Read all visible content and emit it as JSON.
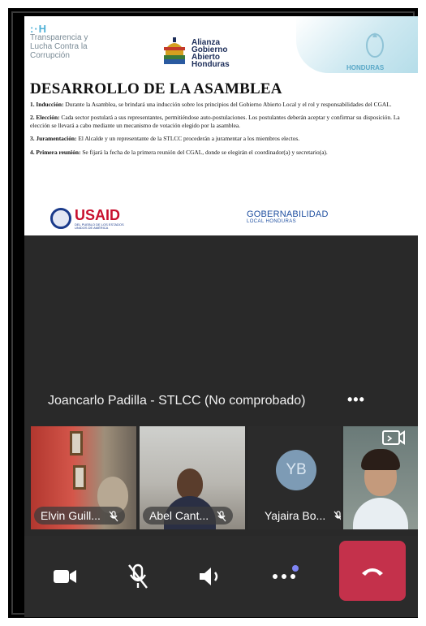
{
  "slide": {
    "logo_left": {
      "mark": ":·H",
      "lines": [
        "Transparencia y",
        "Lucha Contra la",
        "Corrupción"
      ]
    },
    "logo_center": [
      "Alianza",
      "Gobierno",
      "Abierto",
      "Honduras"
    ],
    "logo_right": "HONDURAS",
    "title": "DESARROLLO DE LA ASAMBLEA",
    "points": [
      {
        "label": "1. Inducción:",
        "text": " Durante la Asamblea, se brindará una inducción sobre los principios del Gobierno Abierto Local y el rol y responsabilidades del CGAL."
      },
      {
        "label": "2. Elección:",
        "text": " Cada sector postulará a sus representantes, permitiéndose auto-postulaciones. Los postulantes deberán aceptar y confirmar su disposición. La elección se llevará a cabo mediante un mecanismo de votación elegido por la asamblea."
      },
      {
        "label": "3. Juramentación:",
        "text": " El Alcalde y un representante de la STLCC procederán a juramentar a los miembros electos."
      },
      {
        "label": "4. Primera reunión:",
        "text": " Se fijará la fecha de la primera reunión del CGAL, donde se elegirán el coordinador(a) y secretario(a)."
      }
    ],
    "usaid": {
      "word": "USAID",
      "sub": "DEL PUEBLO DE LOS ESTADOS UNIDOS DE AMÉRICA"
    },
    "gob": {
      "line1": "GOBERNABILIDAD",
      "line2": "LOCAL HONDURAS"
    }
  },
  "speaker": {
    "name": "Joancarlo Padilla - STLCC (No comprobado)",
    "more": "•••"
  },
  "participants": [
    {
      "name": "Elvin Guill...",
      "muted": true
    },
    {
      "name": "Abel Cant...",
      "muted": true
    },
    {
      "name": "Yajaira Bo...",
      "initials": "YB",
      "muted": true
    },
    {
      "name": "",
      "muted": false
    }
  ],
  "toolbar": {
    "camera": "camera-icon",
    "mic": "mic-off-icon",
    "speaker": "speaker-icon",
    "more": "more-icon",
    "hangup": "hang-up-icon"
  },
  "colors": {
    "hangup": "#c4314b",
    "badge": "#7f85f5",
    "background": "#292929"
  }
}
